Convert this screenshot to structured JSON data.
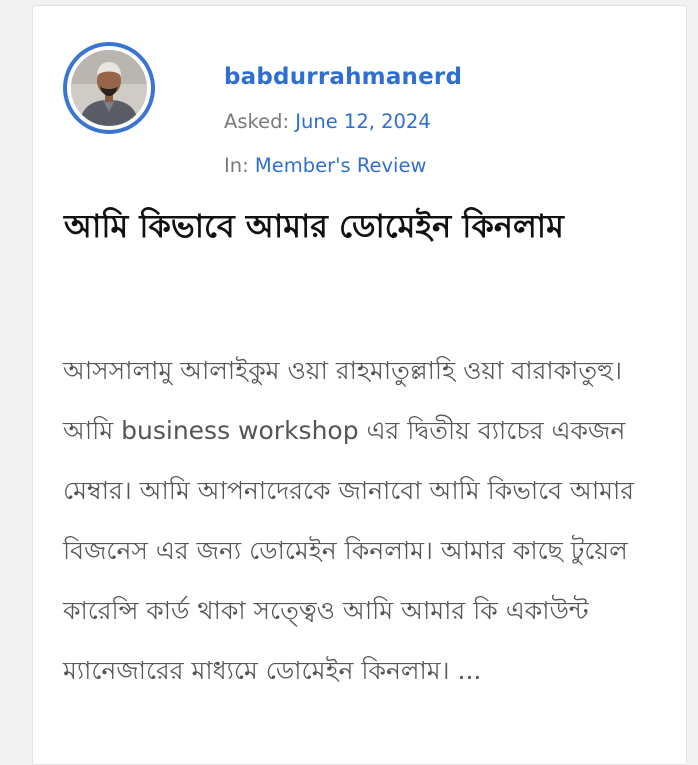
{
  "post": {
    "author": {
      "username": "babdurrahmanerd"
    },
    "asked_label": "Asked:",
    "asked_date": "June 12, 2024",
    "in_label": "In:",
    "category": "Member's Review",
    "title": "আমি কিভাবে আমার ডোমেইন কিনলাম",
    "excerpt": "আসসালামু আলাইকুম ওয়া রাহমাতুল্লাহি ওয়া বারাকাতুহু। আমি business workshop এর দ্বিতীয় ব্যাচের একজন মেম্বার। আমি আপনাদেরকে জানাবো আমি কিভাবে আমার বিজনেস এর জন্য ডোমেইন কিনলাম। আমার কাছে টুয়েল কারেন্সি কার্ড থাকা সত্ত্বেও আমি আমার কি একাউন্ট ম্যানেজারের মাধ্যমে ডোমেইন কিনলাম। ..."
  },
  "colors": {
    "link": "#2f6fd1",
    "avatar_ring": "#3a75d4",
    "muted_text": "#7a7a7a",
    "body_text": "#555555",
    "title_text": "#111111"
  }
}
